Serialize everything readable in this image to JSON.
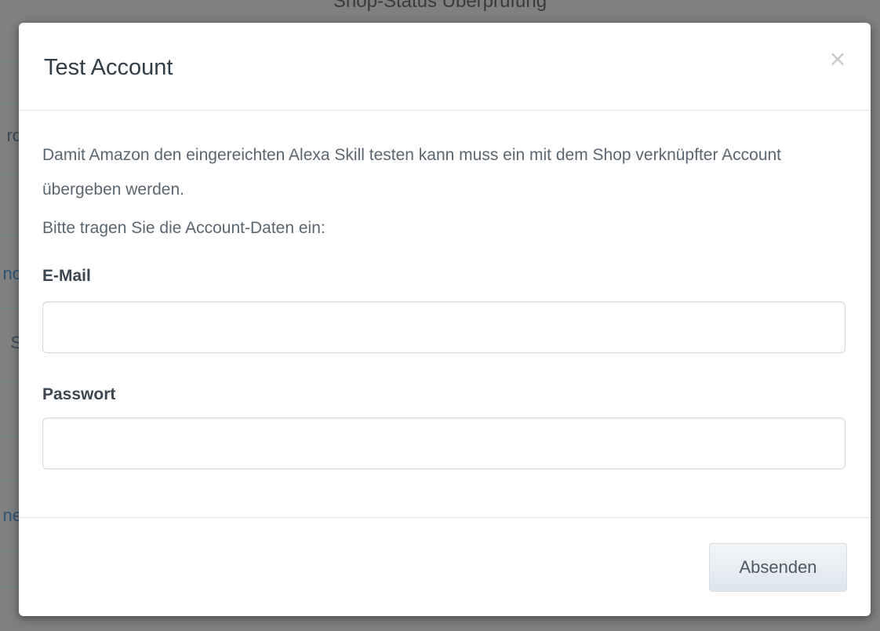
{
  "background": {
    "page_title": "Shop-Status Überprüfung",
    "fragments": [
      "rd",
      "no",
      "S",
      "ne"
    ]
  },
  "modal": {
    "title": "Test Account",
    "close_symbol": "×",
    "intro_text": "Damit Amazon den eingereichten Alexa Skill testen kann muss ein mit dem Shop verknüpfter Account übergeben werden.",
    "prompt_text": "Bitte tragen Sie die Account-Daten ein:",
    "email": {
      "label": "E-Mail",
      "value": "",
      "placeholder": ""
    },
    "password": {
      "label": "Passwort",
      "value": "",
      "placeholder": ""
    },
    "submit_label": "Absenden"
  },
  "icons": {
    "close": "close-icon"
  },
  "colors": {
    "overlay": "#808080",
    "modal_bg": "#ffffff",
    "title": "#333d46",
    "body_text": "#5b6670",
    "button_bg": "#e6ecf1"
  }
}
